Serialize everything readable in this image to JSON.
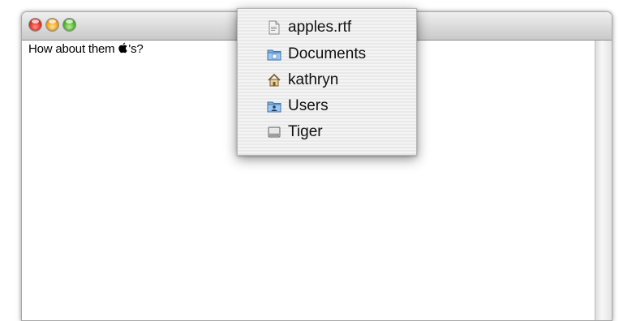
{
  "window": {
    "controls": {
      "close": {
        "color": "#e2332a"
      },
      "minimize": {
        "color": "#f5a623"
      },
      "zoom": {
        "color": "#4fb62f"
      }
    },
    "document_text_before": "How about them ",
    "document_text_after": "'s?"
  },
  "path_menu": {
    "items": [
      {
        "label": "apples.rtf",
        "icon": "document-icon"
      },
      {
        "label": "Documents",
        "icon": "documents-folder-icon"
      },
      {
        "label": "kathryn",
        "icon": "home-icon"
      },
      {
        "label": "Users",
        "icon": "users-folder-icon"
      },
      {
        "label": "Tiger",
        "icon": "hard-drive-icon"
      }
    ]
  }
}
